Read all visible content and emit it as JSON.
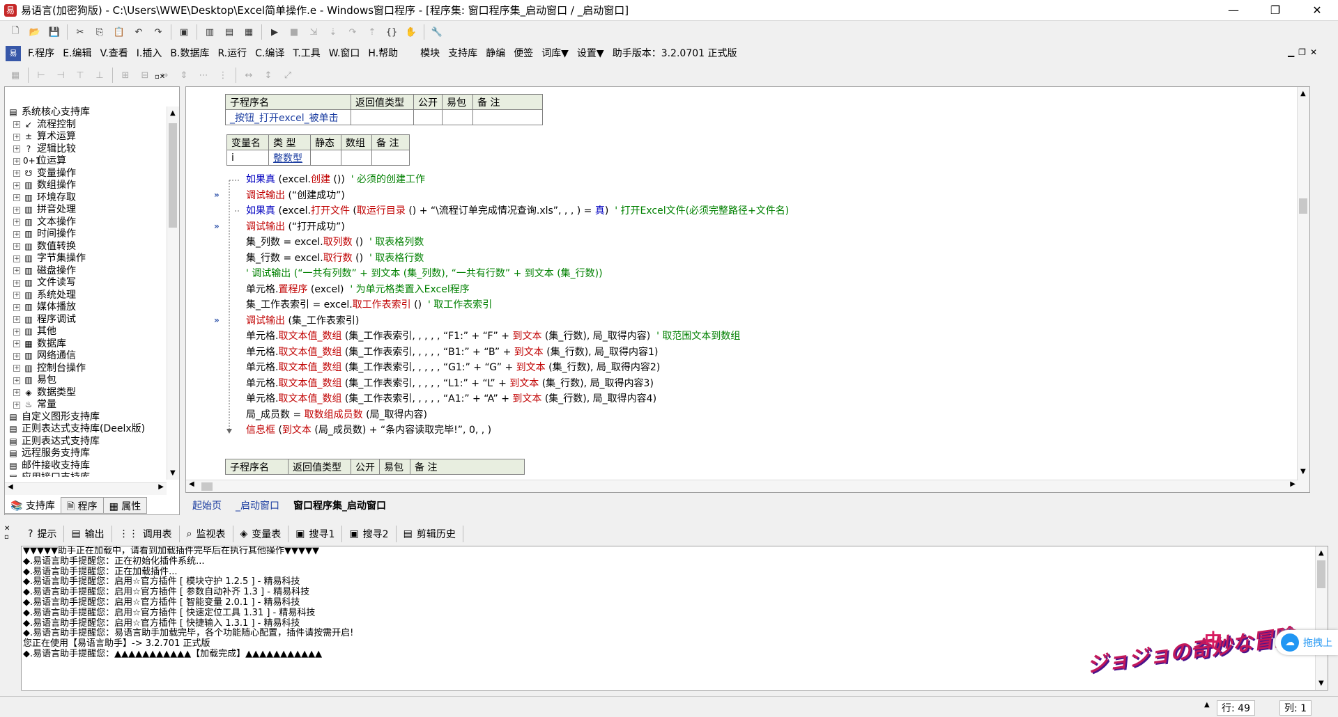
{
  "window": {
    "title": "易语言(加密狗版) - C:\\Users\\WWE\\Desktop\\Excel简单操作.e - Windows窗口程序 - [程序集: 窗口程序集_启动窗口 / _启动窗口]",
    "min": "—",
    "max": "❐",
    "close": "✕"
  },
  "menu": {
    "items": [
      {
        "name": "menu-program",
        "label": "F.程序"
      },
      {
        "name": "menu-edit",
        "label": "E.编辑"
      },
      {
        "name": "menu-view",
        "label": "V.查看"
      },
      {
        "name": "menu-insert",
        "label": "I.插入"
      },
      {
        "name": "menu-database",
        "label": "B.数据库"
      },
      {
        "name": "menu-run",
        "label": "R.运行"
      },
      {
        "name": "menu-compile",
        "label": "C.编译"
      },
      {
        "name": "menu-tools",
        "label": "T.工具"
      },
      {
        "name": "menu-window",
        "label": "W.窗口"
      },
      {
        "name": "menu-help",
        "label": "H.帮助"
      },
      {
        "name": "menu-module",
        "label": "模块"
      },
      {
        "name": "menu-support",
        "label": "支持库"
      },
      {
        "name": "menu-static",
        "label": "静编"
      },
      {
        "name": "menu-notes",
        "label": "便签"
      },
      {
        "name": "menu-dict",
        "label": "词库▼"
      },
      {
        "name": "menu-settings",
        "label": "设置▼"
      },
      {
        "name": "menu-version",
        "label": "助手版本：3.2.0701 正式版"
      }
    ]
  },
  "tree": {
    "items": [
      {
        "icon": "▤",
        "label": "系统核心支持库",
        "level": 0
      },
      {
        "icon": "↙",
        "label": "流程控制",
        "level": 1
      },
      {
        "icon": "±",
        "label": "算术运算",
        "level": 1
      },
      {
        "icon": "?",
        "label": "逻辑比较",
        "level": 1
      },
      {
        "icon": "0+1",
        "label": "位运算",
        "level": 1
      },
      {
        "icon": "☋",
        "label": "变量操作",
        "level": 1
      },
      {
        "icon": "▥",
        "label": "数组操作",
        "level": 1
      },
      {
        "icon": "▥",
        "label": "环境存取",
        "level": 1
      },
      {
        "icon": "▥",
        "label": "拼音处理",
        "level": 1
      },
      {
        "icon": "▥",
        "label": "文本操作",
        "level": 1
      },
      {
        "icon": "▥",
        "label": "时间操作",
        "level": 1
      },
      {
        "icon": "▥",
        "label": "数值转换",
        "level": 1
      },
      {
        "icon": "▥",
        "label": "字节集操作",
        "level": 1
      },
      {
        "icon": "▥",
        "label": "磁盘操作",
        "level": 1
      },
      {
        "icon": "▥",
        "label": "文件读写",
        "level": 1
      },
      {
        "icon": "▥",
        "label": "系统处理",
        "level": 1
      },
      {
        "icon": "▥",
        "label": "媒体播放",
        "level": 1
      },
      {
        "icon": "▥",
        "label": "程序调试",
        "level": 1
      },
      {
        "icon": "▥",
        "label": "其他",
        "level": 1
      },
      {
        "icon": "▦",
        "label": "数据库",
        "level": 1
      },
      {
        "icon": "▥",
        "label": "网络通信",
        "level": 1
      },
      {
        "icon": "▥",
        "label": "控制台操作",
        "level": 1
      },
      {
        "icon": "▥",
        "label": "易包",
        "level": 1
      },
      {
        "icon": "◈",
        "label": "数据类型",
        "level": 1
      },
      {
        "icon": "♨",
        "label": "常量",
        "level": 1
      },
      {
        "icon": "▤",
        "label": "自定义图形支持库",
        "level": 0
      },
      {
        "icon": "▤",
        "label": "正则表达式支持库(Deelx版)",
        "level": 0
      },
      {
        "icon": "▤",
        "label": "正则表达式支持库",
        "level": 0
      },
      {
        "icon": "▤",
        "label": "远程服务支持库",
        "level": 0
      },
      {
        "icon": "▤",
        "label": "邮件接收支持库",
        "level": 0
      },
      {
        "icon": "▤",
        "label": "应用接口支持库",
        "level": 0
      }
    ]
  },
  "left_tabs": [
    "支持库",
    "程序",
    "属性"
  ],
  "sub1": {
    "headers": [
      "子程序名",
      "返回值类型",
      "公开",
      "易包",
      "备 注"
    ],
    "name": "_按钮_打开excel_被单击",
    "var_headers": [
      "变量名",
      "类 型",
      "静态",
      "数组",
      "备 注"
    ],
    "var_name": "i",
    "var_type": "整数型"
  },
  "code": [
    [
      [
        "k",
        "如果真"
      ],
      [
        "v",
        " (excel."
      ],
      [
        "f",
        "创建"
      ],
      [
        "v",
        " ())"
      ],
      [
        "c",
        "  ' 必须的创建工作"
      ]
    ],
    [
      [
        "f",
        "调试输出"
      ],
      [
        "v",
        " (“创建成功”)"
      ]
    ],
    [
      [
        "k",
        "如果真"
      ],
      [
        "v",
        " (excel."
      ],
      [
        "f",
        "打开文件"
      ],
      [
        "v",
        " ("
      ],
      [
        "f",
        "取运行目录"
      ],
      [
        "v",
        " () + “\\流程订单完成情况查询.xls”, , , ) = "
      ],
      [
        "k",
        "真"
      ],
      [
        "v",
        ")"
      ],
      [
        "c",
        "  ' 打开Excel文件(必须完整路径+文件名)"
      ]
    ],
    [
      [
        "f",
        "调试输出"
      ],
      [
        "v",
        " (“打开成功”)"
      ]
    ],
    [
      [
        "v",
        "集_列数 = excel."
      ],
      [
        "f",
        "取列数"
      ],
      [
        "v",
        " ()"
      ],
      [
        "c",
        "  ' 取表格列数"
      ]
    ],
    [
      [
        "v",
        "集_行数 = excel."
      ],
      [
        "f",
        "取行数"
      ],
      [
        "v",
        " ()"
      ],
      [
        "c",
        "  ' 取表格行数"
      ]
    ],
    [
      [
        "c",
        "' 调试输出 (“一共有列数” + 到文本 (集_列数), “一共有行数” + 到文本 (集_行数))"
      ]
    ],
    [
      [
        "v",
        "单元格."
      ],
      [
        "f",
        "置程序"
      ],
      [
        "v",
        " (excel)"
      ],
      [
        "c",
        "  ' 为单元格类置入Excel程序"
      ]
    ],
    [
      [
        "v",
        "集_工作表索引 = excel."
      ],
      [
        "f",
        "取工作表索引"
      ],
      [
        "v",
        " ()"
      ],
      [
        "c",
        "  ' 取工作表索引"
      ]
    ],
    [
      [
        "f",
        "调试输出"
      ],
      [
        "v",
        " (集_工作表索引)"
      ]
    ],
    [
      [
        "v",
        "单元格."
      ],
      [
        "f",
        "取文本值_数组"
      ],
      [
        "v",
        " (集_工作表索引, , , , , “F1:” + “F” + "
      ],
      [
        "f",
        "到文本"
      ],
      [
        "v",
        " (集_行数), 局_取得内容)"
      ],
      [
        "c",
        "  ' 取范围文本到数组"
      ]
    ],
    [
      [
        "v",
        "单元格."
      ],
      [
        "f",
        "取文本值_数组"
      ],
      [
        "v",
        " (集_工作表索引, , , , , “B1:” + “B” + "
      ],
      [
        "f",
        "到文本"
      ],
      [
        "v",
        " (集_行数), 局_取得内容1)"
      ]
    ],
    [
      [
        "v",
        "单元格."
      ],
      [
        "f",
        "取文本值_数组"
      ],
      [
        "v",
        " (集_工作表索引, , , , , “G1:” + “G” + "
      ],
      [
        "f",
        "到文本"
      ],
      [
        "v",
        " (集_行数), 局_取得内容2)"
      ]
    ],
    [
      [
        "v",
        "单元格."
      ],
      [
        "f",
        "取文本值_数组"
      ],
      [
        "v",
        " (集_工作表索引, , , , , “L1:” + “L” + "
      ],
      [
        "f",
        "到文本"
      ],
      [
        "v",
        " (集_行数), 局_取得内容3)"
      ]
    ],
    [
      [
        "v",
        "单元格."
      ],
      [
        "f",
        "取文本值_数组"
      ],
      [
        "v",
        " (集_工作表索引, , , , , “A1:” + “A” + "
      ],
      [
        "f",
        "到文本"
      ],
      [
        "v",
        " (集_行数), 局_取得内容4)"
      ]
    ],
    [
      [
        "v",
        "局_成员数 = "
      ],
      [
        "f",
        "取数组成员数"
      ],
      [
        "v",
        " (局_取得内容)"
      ]
    ],
    [
      [
        "f",
        "信息框"
      ],
      [
        "v",
        " ("
      ],
      [
        "f",
        "到文本"
      ],
      [
        "v",
        " (局_成员数) + “条内容读取完毕!”, 0, , )"
      ]
    ]
  ],
  "sub2": {
    "headers": [
      "子程序名",
      "返回值类型",
      "公开",
      "易包",
      "备 注"
    ]
  },
  "editor_tabs": [
    "起始页",
    "_启动窗口",
    "窗口程序集_启动窗口"
  ],
  "bottom_tabs": [
    {
      "icon": "?",
      "label": "提示"
    },
    {
      "icon": "▤",
      "label": "输出"
    },
    {
      "icon": "⋮⋮",
      "label": "调用表"
    },
    {
      "icon": "⌕",
      "label": "监视表"
    },
    {
      "icon": "◈",
      "label": "变量表"
    },
    {
      "icon": "▣",
      "label": "搜寻1"
    },
    {
      "icon": "▣",
      "label": "搜寻2"
    },
    {
      "icon": "▤",
      "label": "剪辑历史"
    }
  ],
  "output": [
    "▼▼▼▼▼助手正在加载中，请看到加载插件完毕后在执行其他操作▼▼▼▼▼",
    "◆.易语言助手提醒您：正在初始化插件系统...",
    "◆.易语言助手提醒您：正在加载插件...",
    "◆.易语言助手提醒您：启用☆官方插件 [ 模块守护 1.2.5 ] - 精易科技",
    "◆.易语言助手提醒您：启用☆官方插件 [ 参数自动补齐 1.3 ] - 精易科技",
    "◆.易语言助手提醒您：启用☆官方插件 [ 智能变量 2.0.1 ] - 精易科技",
    "◆.易语言助手提醒您：启用☆官方插件 [ 快速定位工具 1.31 ] - 精易科技",
    "◆.易语言助手提醒您：启用☆官方插件 [ 快捷输入 1.3.1 ] - 精易科技",
    "◆.易语言助手提醒您：易语言助手加载完毕，各个功能随心配置，插件请按需开启!",
    "您正在使用【易语言助手】->  3.2.701 正式版",
    "◆.易语言助手提醒您：▲▲▲▲▲▲▲▲▲▲▲【加载完成】▲▲▲▲▲▲▲▲▲▲▲"
  ],
  "status": {
    "line": "行: 49",
    "col": "列: 1"
  },
  "logo": {
    "text": "ジョジョの奇妙な冒険",
    "badge": "中"
  },
  "side_widget": {
    "label": "拖拽上"
  },
  "colors": {
    "keyword": "#0000c0",
    "function": "#c00000",
    "comment": "#008000"
  }
}
